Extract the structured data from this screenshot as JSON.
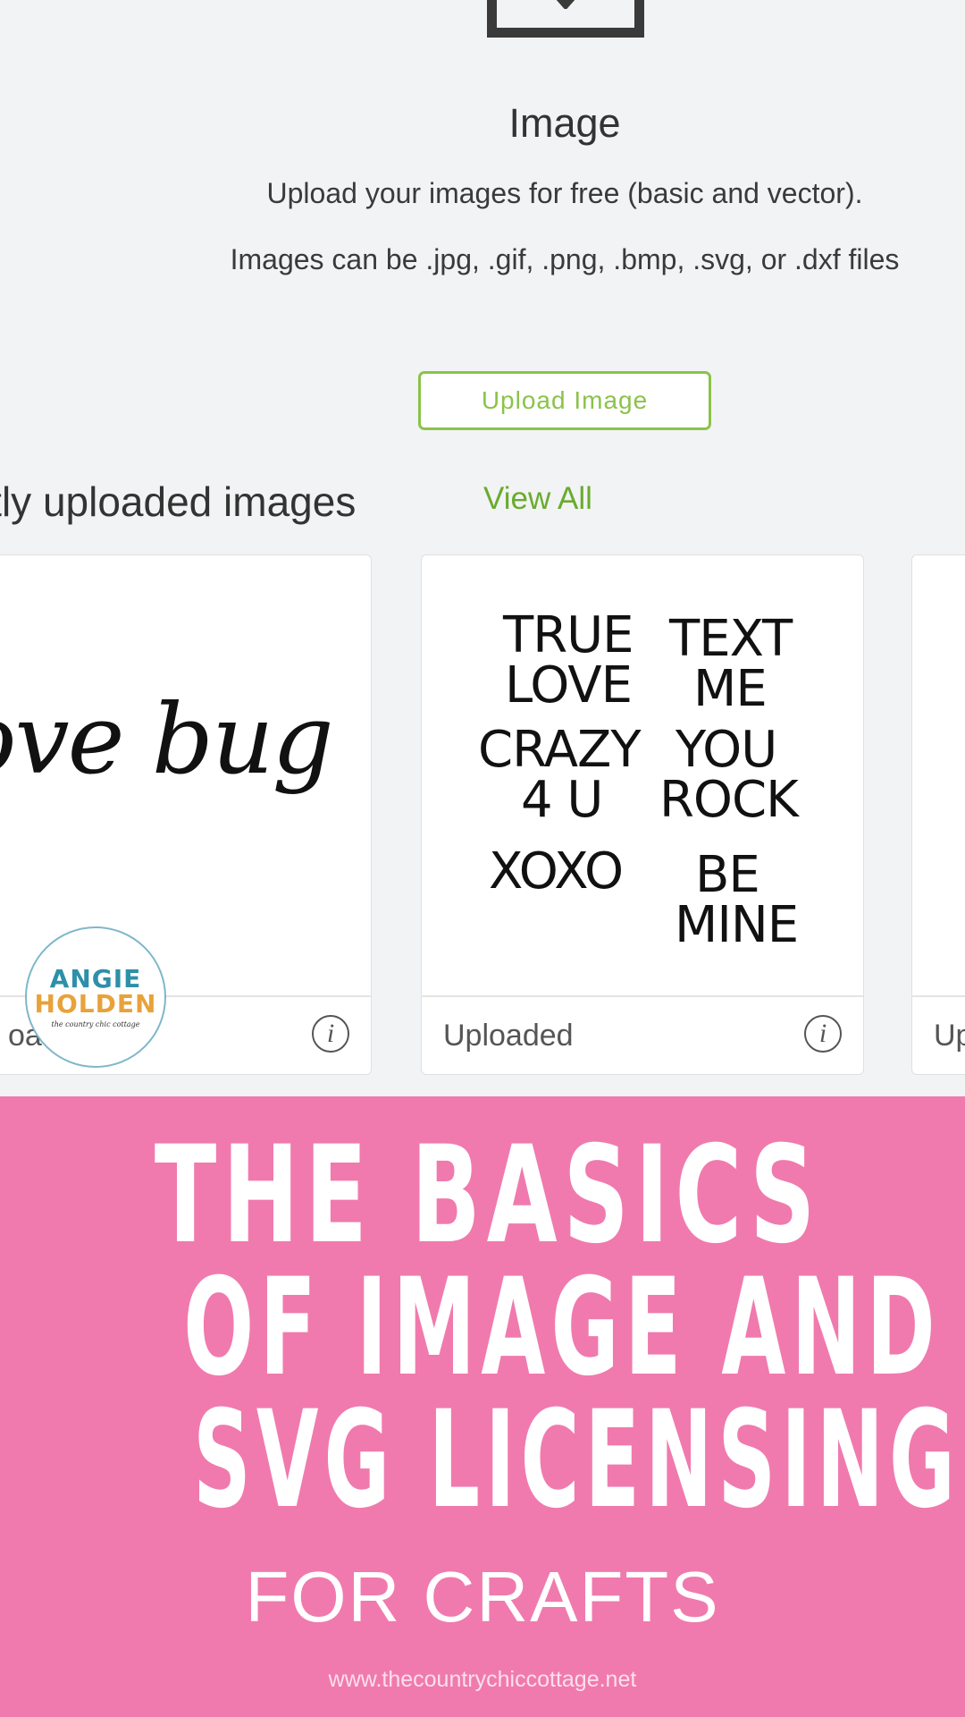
{
  "upload_panel": {
    "title": "Image",
    "description": "Upload your images for free (basic and vector).",
    "formats": "Images can be .jpg, .gif, .png, .bmp, .svg, or .dxf files",
    "button_label": "Upload Image"
  },
  "recent": {
    "heading": "ently uploaded images",
    "view_all": "View All",
    "cards": [
      {
        "image_text": "love bug",
        "label": "oad"
      },
      {
        "image_words": [
          "TRUE",
          "LOVE",
          "TEXT",
          "ME",
          "CRAZY",
          "4 U",
          "YOU",
          "ROCK",
          "XOXO",
          "BE",
          "MINE"
        ],
        "label": "Uploaded"
      },
      {
        "label": "Up"
      }
    ],
    "info_symbol": "i"
  },
  "logo": {
    "line1": "ANGIE",
    "line2": "HOLDEN",
    "tagline": "the country chic cottage"
  },
  "banner": {
    "line1": "THE BASICS",
    "line2": "OF IMAGE AND",
    "line3": "SVG LICENSING",
    "subtitle": "FOR CRAFTS",
    "url": "www.thecountrychiccottage.net",
    "background": "#f07aae"
  },
  "colors": {
    "accent_green": "#8bc34a",
    "page_gray": "#f2f3f4"
  }
}
